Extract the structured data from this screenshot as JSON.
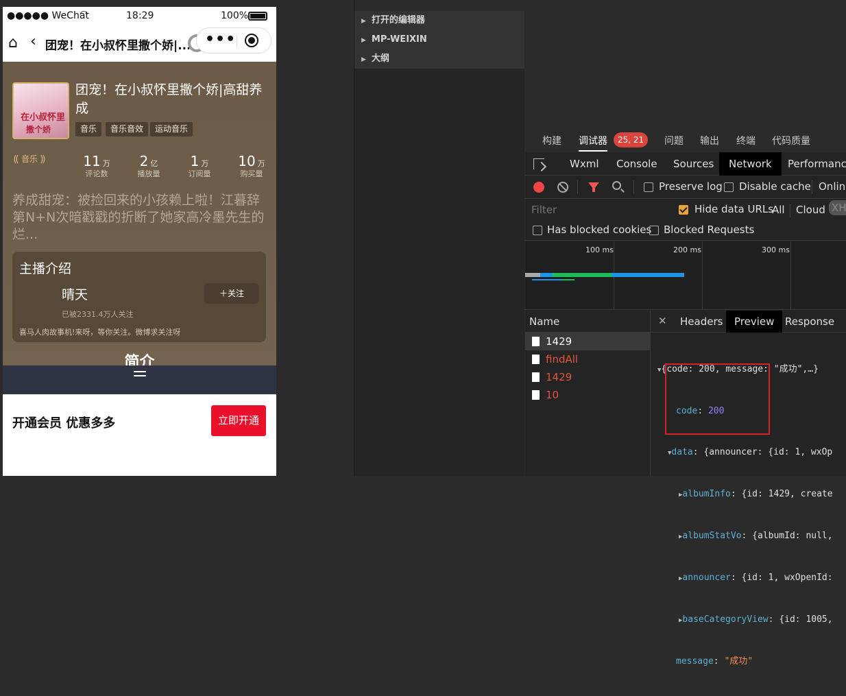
{
  "phone": {
    "status": {
      "carrier": "●●●●● WeChat",
      "wifi": "wifi",
      "time": "18:29",
      "battery": "100%"
    },
    "nav": {
      "title": "团宠！在小叔怀里撒个娇|..."
    },
    "album": {
      "title": "团宠！在小叔怀里撒个娇|高甜养成",
      "cover_line1": "在小叔怀里",
      "cover_line2": "撒个娇",
      "tags": [
        "音乐",
        "音乐音效",
        "运动音乐"
      ],
      "badge": "音乐",
      "stats": [
        {
          "num": "11",
          "unit": "万",
          "label": "评论数"
        },
        {
          "num": "2",
          "unit": "亿",
          "label": "播放量"
        },
        {
          "num": "1",
          "unit": "万",
          "label": "订阅量"
        },
        {
          "num": "10",
          "unit": "万",
          "label": "购买量"
        }
      ],
      "description": "养成甜宠：被捡回来的小孩赖上啦！江暮辞第N+N次暗戳戳的折断了她家高冷墨先生的烂..."
    },
    "host": {
      "section_title": "主播介绍",
      "name": "晴天",
      "follow_label": "＋关注",
      "follower_count": "已被2331.4万人关注",
      "bio": "喜马人肉故事机!来呀，等你关注。微博求关注呀"
    },
    "section_peek": "简介",
    "vip": {
      "text": "开通会员 优惠多多",
      "button": "立即开通"
    }
  },
  "explorer": {
    "items": [
      "打开的编辑器",
      "MP-WEIXIN",
      "大纲"
    ]
  },
  "devtools": {
    "tabs": [
      "构建",
      "调试器",
      "问题",
      "输出",
      "终端",
      "代码质量"
    ],
    "error_badge": "25, 21",
    "panel_tabs": [
      "Wxml",
      "Console",
      "Sources",
      "Network",
      "Performance"
    ],
    "toolbar": {
      "preserve_log": "Preserve log",
      "disable_cache": "Disable cache",
      "online": "Online"
    },
    "filter": {
      "placeholder": "Filter",
      "hide_data_urls": "Hide data URLs",
      "all": "All",
      "cloud": "Cloud",
      "xhr": "XHR"
    },
    "blocked": {
      "cookies": "Has blocked cookies",
      "requests": "Blocked Requests"
    },
    "timeline_labels": [
      "100 ms",
      "200 ms",
      "300 ms"
    ],
    "name_header": "Name",
    "requests": [
      {
        "name": "1429",
        "status": "ok"
      },
      {
        "name": "findAll",
        "status": "error"
      },
      {
        "name": "1429",
        "status": "error"
      },
      {
        "name": "10",
        "status": "error"
      }
    ],
    "preview_tabs": [
      "Headers",
      "Preview",
      "Response"
    ],
    "json": {
      "root": "{code: 200, message: \"成功\",…}",
      "code_key": "code",
      "code_val": "200",
      "data_key": "data",
      "data_summary": "{announcer: {id: 1, wxOp",
      "album_info_key": "albumInfo",
      "album_info_val": "{id: 1429, create",
      "album_stat_key": "albumStatVo",
      "album_stat_val": "{albumId: null,",
      "announcer_key": "announcer",
      "announcer_val": "{id: 1, wxOpenId:",
      "base_cat_key": "baseCategoryView",
      "base_cat_val": "{id: 1005,",
      "message_key": "message",
      "message_val": "\"成功\""
    }
  }
}
